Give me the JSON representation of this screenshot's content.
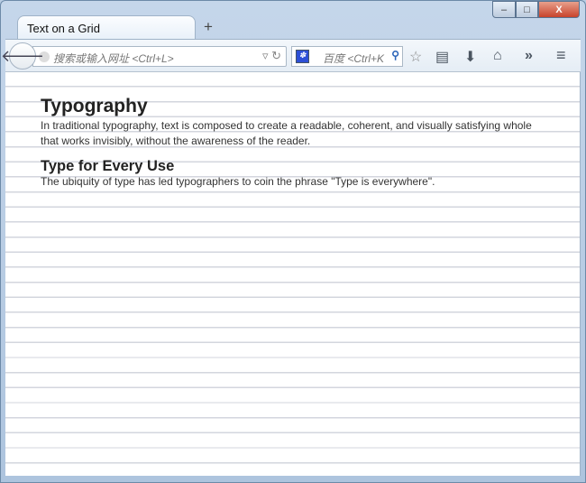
{
  "window": {
    "minimize": "–",
    "maximize": "□",
    "close": "X"
  },
  "tab": {
    "title": "Text on a Grid",
    "new_tab": "+"
  },
  "toolbar": {
    "url_placeholder": "搜索或输入网址 <Ctrl+L>",
    "search_placeholder": "百度 <Ctrl+K"
  },
  "page": {
    "h1": "Typography",
    "p1": "In traditional typography, text is composed to create a readable, coherent, and visually satisfying whole that works invisibly, without the awareness of the reader.",
    "h2": "Type for Every Use",
    "p2": "The ubiquity of type has led typographers to coin the phrase \"Type is everywhere\"."
  }
}
